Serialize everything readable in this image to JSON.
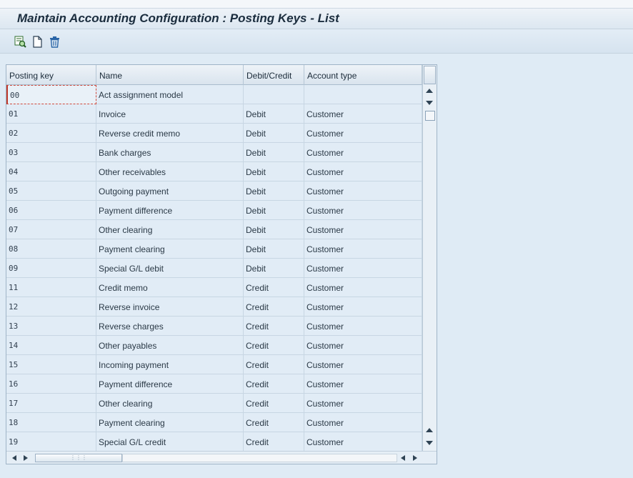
{
  "window": {
    "title": "Maintain Accounting Configuration : Posting Keys - List"
  },
  "toolbar": {
    "buttons": [
      {
        "name": "details-button",
        "icon": "detail-view-icon"
      },
      {
        "name": "new-entry-button",
        "icon": "new-document-icon"
      },
      {
        "name": "delete-button",
        "icon": "trash-icon"
      }
    ]
  },
  "table": {
    "columns": [
      "Posting key",
      "Name",
      "Debit/Credit",
      "Account type"
    ],
    "rows": [
      [
        "00",
        "Act assignment model",
        "",
        ""
      ],
      [
        "01",
        "Invoice",
        "Debit",
        "Customer"
      ],
      [
        "02",
        "Reverse credit memo",
        "Debit",
        "Customer"
      ],
      [
        "03",
        "Bank charges",
        "Debit",
        "Customer"
      ],
      [
        "04",
        "Other receivables",
        "Debit",
        "Customer"
      ],
      [
        "05",
        "Outgoing payment",
        "Debit",
        "Customer"
      ],
      [
        "06",
        "Payment difference",
        "Debit",
        "Customer"
      ],
      [
        "07",
        "Other clearing",
        "Debit",
        "Customer"
      ],
      [
        "08",
        "Payment clearing",
        "Debit",
        "Customer"
      ],
      [
        "09",
        "Special G/L debit",
        "Debit",
        "Customer"
      ],
      [
        "11",
        "Credit memo",
        "Credit",
        "Customer"
      ],
      [
        "12",
        "Reverse invoice",
        "Credit",
        "Customer"
      ],
      [
        "13",
        "Reverse charges",
        "Credit",
        "Customer"
      ],
      [
        "14",
        "Other payables",
        "Credit",
        "Customer"
      ],
      [
        "15",
        "Incoming payment",
        "Credit",
        "Customer"
      ],
      [
        "16",
        "Payment difference",
        "Credit",
        "Customer"
      ],
      [
        "17",
        "Other clearing",
        "Credit",
        "Customer"
      ],
      [
        "18",
        "Payment clearing",
        "Credit",
        "Customer"
      ],
      [
        "19",
        "Special G/L credit",
        "Credit",
        "Customer"
      ]
    ]
  },
  "colors": {
    "background": "#dfebf5",
    "row": "#e1ecf6",
    "focus": "#c0392b"
  }
}
